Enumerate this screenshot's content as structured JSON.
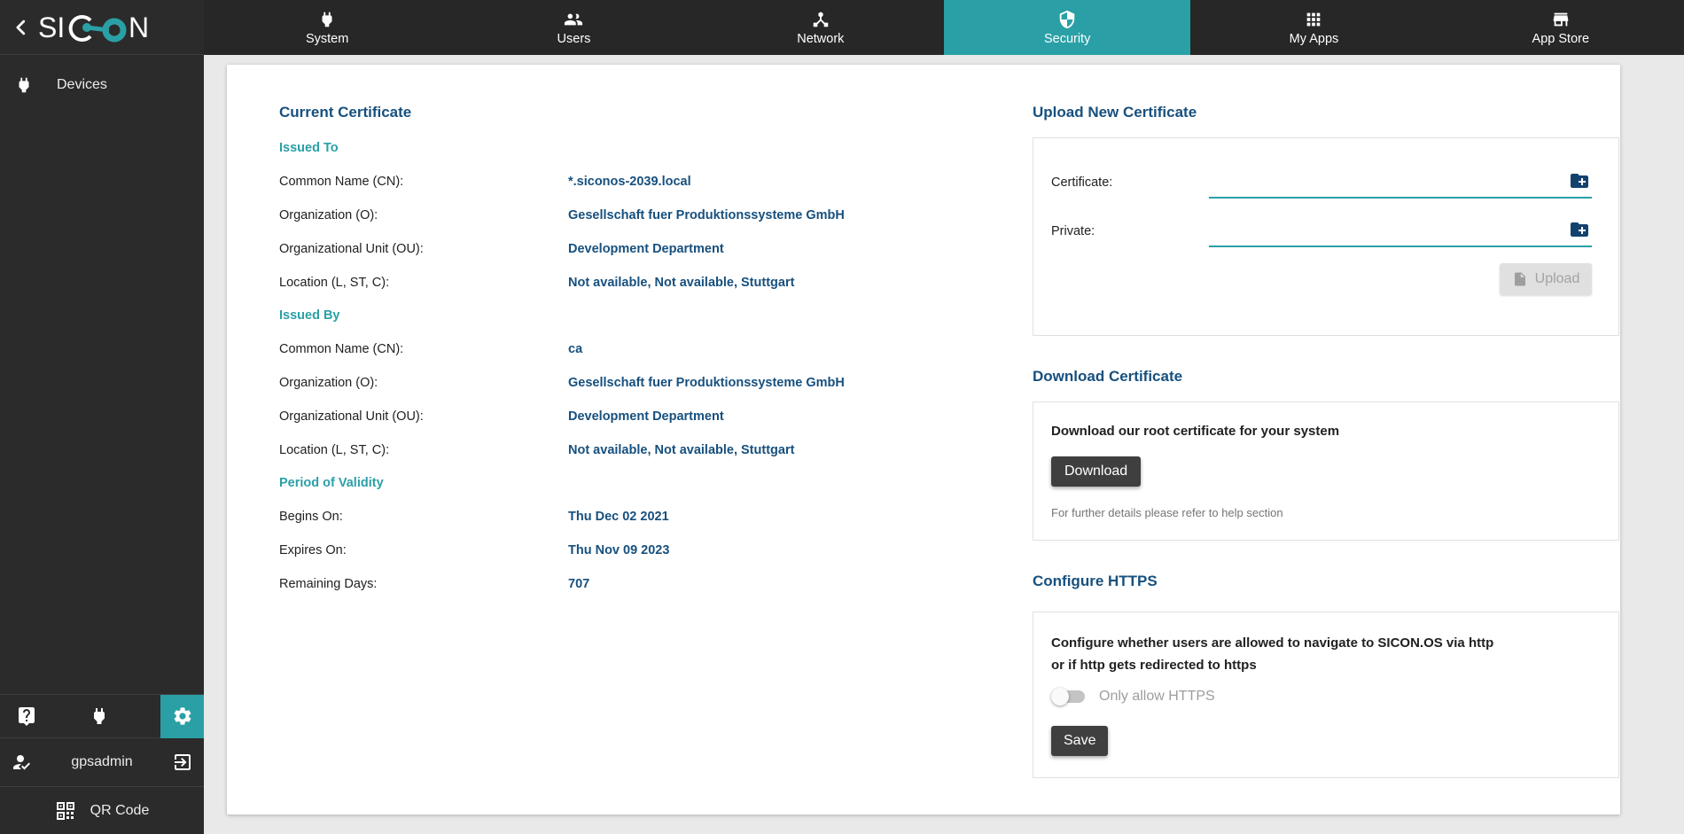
{
  "app": {
    "logo_left": "SI",
    "logo_right": "N"
  },
  "nav": {
    "tabs": [
      {
        "label": "System"
      },
      {
        "label": "Users"
      },
      {
        "label": "Network"
      },
      {
        "label": "Security"
      },
      {
        "label": "My Apps"
      },
      {
        "label": "App Store"
      }
    ]
  },
  "sidebar": {
    "devices_label": "Devices",
    "username": "gpsadmin",
    "qr_label": "QR Code"
  },
  "certificate": {
    "title": "Current Certificate",
    "sections": [
      {
        "heading": "Issued To",
        "rows": [
          {
            "label": "Common Name (CN):",
            "value": "*.siconos-2039.local"
          },
          {
            "label": "Organization (O):",
            "value": "Gesellschaft fuer Produktionssysteme GmbH"
          },
          {
            "label": "Organizational Unit (OU):",
            "value": "Development Department"
          },
          {
            "label": "Location (L, ST, C):",
            "value": "Not available, Not available, Stuttgart"
          }
        ]
      },
      {
        "heading": "Issued By",
        "rows": [
          {
            "label": "Common Name (CN):",
            "value": "ca"
          },
          {
            "label": "Organization (O):",
            "value": "Gesellschaft fuer Produktionssysteme GmbH"
          },
          {
            "label": "Organizational Unit (OU):",
            "value": "Development Department"
          },
          {
            "label": "Location (L, ST, C):",
            "value": "Not available, Not available, Stuttgart"
          }
        ]
      },
      {
        "heading": "Period of Validity",
        "rows": [
          {
            "label": "Begins On:",
            "value": "Thu Dec 02 2021"
          },
          {
            "label": "Expires On:",
            "value": "Thu Nov 09 2023"
          },
          {
            "label": "Remaining Days:",
            "value": "707"
          }
        ]
      }
    ]
  },
  "upload": {
    "title": "Upload New Certificate",
    "certificate_label": "Certificate:",
    "private_label": "Private:",
    "upload_button": "Upload"
  },
  "download": {
    "title": "Download Certificate",
    "description": "Download our root certificate for your system",
    "button": "Download",
    "note": "For further details please refer to help section"
  },
  "https": {
    "title": "Configure HTTPS",
    "description_line1": "Configure whether users are allowed to navigate to SICON.OS via http",
    "description_line2": "or if http gets redirected to https",
    "toggle_label": "Only allow HTTPS",
    "toggle_state": "off",
    "save_button": "Save"
  },
  "colors": {
    "accent_teal": "#2aa0a6",
    "heading_navy": "#17507e",
    "dark_button": "#3f3f3f",
    "nav_background": "#272727",
    "sidebar_background": "#2b2b2b"
  }
}
